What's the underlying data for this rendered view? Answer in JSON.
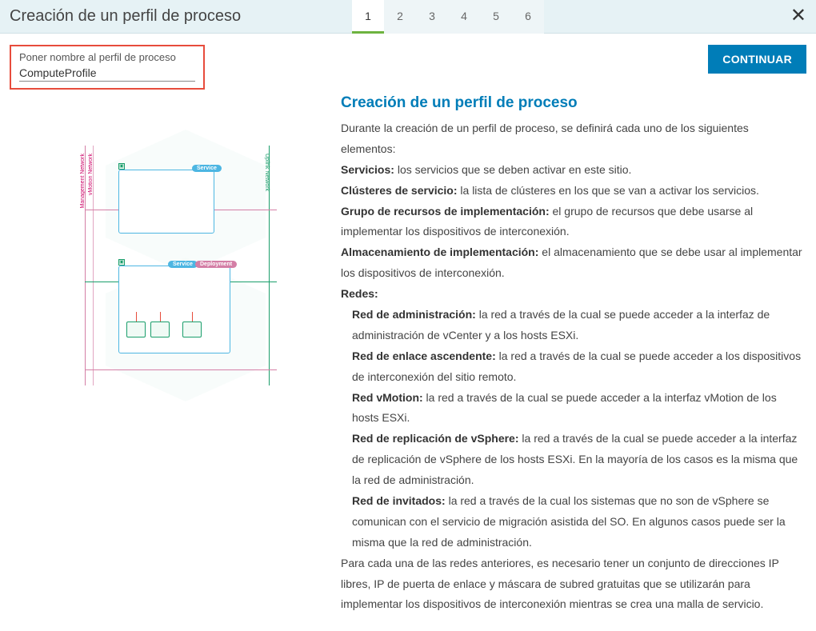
{
  "header": {
    "title": "Creación de un perfil de proceso",
    "steps": [
      "1",
      "2",
      "3",
      "4",
      "5",
      "6"
    ],
    "active_step_index": 0,
    "close_glyph": "✕"
  },
  "form": {
    "name_label": "Poner nombre al perfil de proceso",
    "name_value": "ComputeProfile"
  },
  "buttons": {
    "continue": "CONTINUAR"
  },
  "info": {
    "title": "Creación de un perfil de proceso",
    "intro": "Durante la creación de un perfil de proceso, se definirá cada uno de los siguientes elementos:",
    "items": [
      {
        "label": "Servicios:",
        "text": " los servicios que se deben activar en este sitio."
      },
      {
        "label": "Clústeres de servicio:",
        "text": "  la lista de clústeres en los que se van a activar los servicios."
      },
      {
        "label": "Grupo de recursos de implementación:",
        "text": " el grupo de recursos que debe usarse al implementar los dispositivos de interconexión."
      },
      {
        "label": "Almacenamiento de implementación:",
        "text": "  el almacenamiento que se debe usar al implementar los dispositivos de interconexión."
      }
    ],
    "redes_label": "Redes:",
    "redes": [
      {
        "label": "Red de administración:",
        "text": " la red a través de la cual se puede acceder a la interfaz de administración de vCenter y a los hosts ESXi."
      },
      {
        "label": "Red de enlace ascendente:",
        "text": " la red a través de la cual se puede acceder a los dispositivos de interconexión del sitio remoto."
      },
      {
        "label": "Red vMotion:",
        "text": " la red a través de la cual se puede acceder a la interfaz vMotion de los hosts ESXi."
      },
      {
        "label": "Red de replicación de vSphere:",
        "text": " la red a través de la cual se puede acceder a la interfaz de replicación de vSphere de los hosts ESXi. En la mayoría de los casos es la misma que la red de administración."
      },
      {
        "label": "Red de invitados:",
        "text": " la red a través de la cual los sistemas que no son de vSphere se comunican con el servicio de migración asistida del SO. En algunos casos puede ser la misma que la red de administración."
      }
    ],
    "footer": "Para cada una de las redes anteriores, es necesario tener un conjunto de direcciones IP libres, IP de puerta de enlace y máscara de subred gratuitas que se utilizarán para implementar los dispositivos de interconexión mientras se crea una malla de servicio."
  },
  "diagram": {
    "badges": {
      "service": "Service",
      "deployment": "Deployment"
    },
    "side_labels": {
      "mgmt": "Management Network",
      "vmotion": "vMotion Network",
      "uplink": "Uplink Network"
    }
  }
}
